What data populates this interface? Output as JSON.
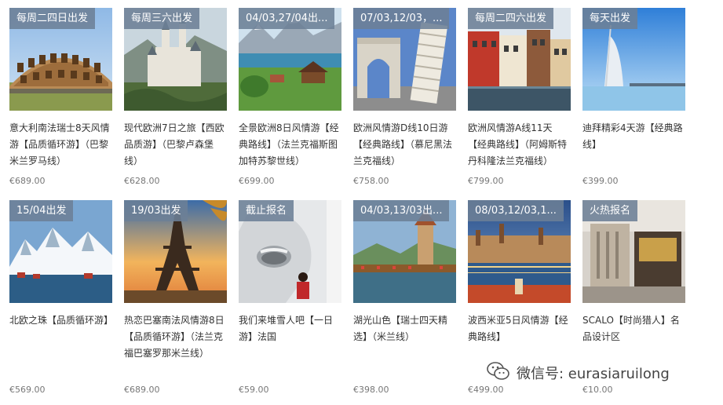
{
  "products": [
    {
      "badge": "每周二四日出发",
      "title": "意大利南法瑞士8天风情游【品质循环游】（巴黎米兰罗马线）",
      "price": "€689.00",
      "image": "colosseum"
    },
    {
      "badge": "每周三六出发",
      "title": "现代欧洲7日之旅【西欧品质游】（巴黎卢森堡线）",
      "price": "€628.00",
      "image": "castle"
    },
    {
      "badge": "04/03,27/04出...",
      "title": "全景欧洲8日风情游【经典路线】（法兰克福斯图加特苏黎世线）",
      "price": "€699.00",
      "image": "alpine-lake"
    },
    {
      "badge": "07/03,12/03，...",
      "title": "欧洲风情游D线10日游【经典路线】（慕尼黑法兰克福线）",
      "price": "€758.00",
      "image": "pisa-arch"
    },
    {
      "badge": "每周二四六出发",
      "title": "欧洲风情游A线11天【经典路线】（阿姆斯特丹科隆法兰克福线）",
      "price": "€799.00",
      "image": "canal-houses"
    },
    {
      "badge": "每天出发",
      "title": "迪拜精彩4天游【经典路线】",
      "price": "€399.00",
      "image": "burj-al-arab"
    },
    {
      "badge": "15/04出发",
      "title": "北欧之珠【品质循环游】",
      "price": "€569.00",
      "image": "lofoten"
    },
    {
      "badge": "19/03出发",
      "title": "热恋巴塞南法风情游8日【品质循环游】（法兰克福巴塞罗那米兰线）",
      "price": "€689.00",
      "image": "eiffel"
    },
    {
      "badge": "截止报名",
      "title": "我们来堆雪人吧【一日游】法国",
      "price": "€59.00",
      "image": "snow-sculpture"
    },
    {
      "badge": "04/03,13/03出...",
      "title": "湖光山色【瑞士四天精选】（米兰线）",
      "price": "€398.00",
      "image": "lucerne"
    },
    {
      "badge": "08/03,12/03,1...",
      "title": "波西米亚5日风情游【经典路线】",
      "price": "€499.00",
      "image": "prague"
    },
    {
      "badge": "火热报名",
      "title": "SCALO【时尚猎人】名品设计区",
      "price": "€10.00",
      "image": "scalo-outlet"
    }
  ],
  "watermark": {
    "text": "微信号: eurasiaruilong",
    "icon": "wechat-icon"
  },
  "colors": {
    "badge_bg": "#6c8096",
    "price": "#777777",
    "title": "#333333"
  }
}
